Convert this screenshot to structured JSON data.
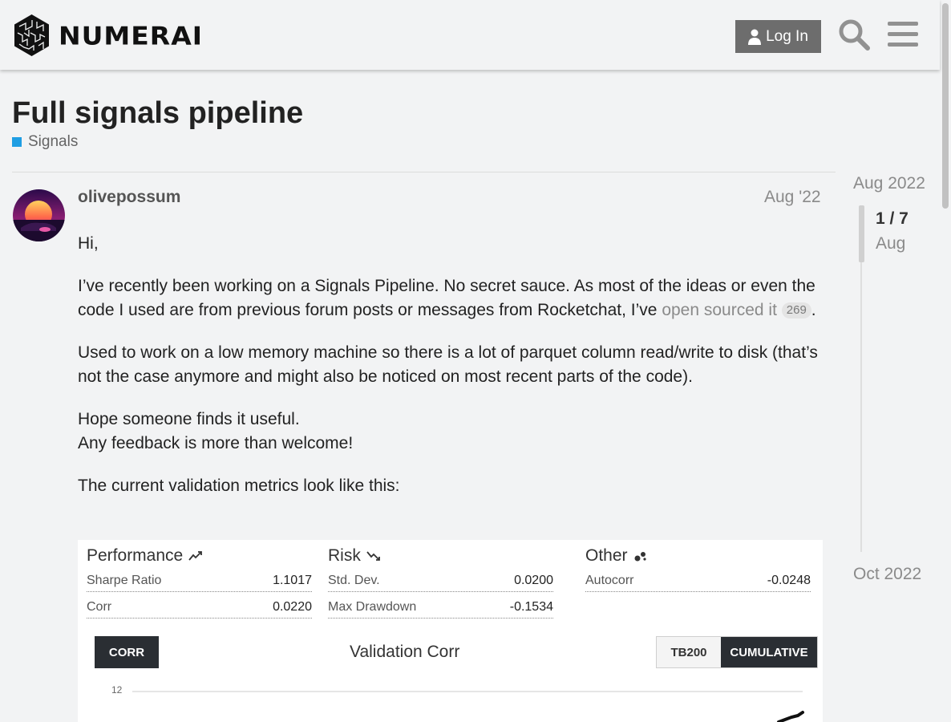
{
  "header": {
    "logo_text": "NUMERAI",
    "login_label": "Log In",
    "search_icon": "search-icon",
    "menu_icon": "hamburger-menu-icon"
  },
  "topic": {
    "title": "Full signals pipeline",
    "category": "Signals",
    "category_color": "#1f9ee3"
  },
  "post": {
    "username": "olivepossum",
    "date": "Aug '22",
    "greeting": "Hi,",
    "p1_text": "I’ve recently been working on a Signals Pipeline. No secret sauce. As most of the ideas or even the code I used are from previous forum posts or messages from Rocketchat, I’ve ",
    "p1_link": "open sourced it",
    "p1_link_clicks": "269",
    "p1_end": ".",
    "p2": "Used to work on a low memory machine so there is a lot of parquet column read/write to disk (that’s not the case anymore and might also be noticed on most recent parts of the code).",
    "p3_line1": "Hope someone finds it useful.",
    "p3_line2": "Any feedback is more than welcome!",
    "p4": "The current validation metrics look like this:"
  },
  "metrics_image": {
    "performance": {
      "heading": "Performance",
      "rows": [
        {
          "label": "Sharpe Ratio",
          "value": "1.1017"
        },
        {
          "label": "Corr",
          "value": "0.0220"
        }
      ]
    },
    "risk": {
      "heading": "Risk",
      "rows": [
        {
          "label": "Std. Dev.",
          "value": "0.0200"
        },
        {
          "label": "Max Drawdown",
          "value": "-0.1534"
        }
      ]
    },
    "other": {
      "heading": "Other",
      "rows": [
        {
          "label": "Autocorr",
          "value": "-0.0248"
        }
      ]
    },
    "corr_button": "CORR",
    "chart_title": "Validation Corr",
    "toggle_tb200": "TB200",
    "toggle_cumulative": "CUMULATIVE",
    "y_tick": "12"
  },
  "timeline": {
    "start": "Aug 2022",
    "position": "1 / 7",
    "position_month": "Aug",
    "end": "Oct 2022"
  }
}
